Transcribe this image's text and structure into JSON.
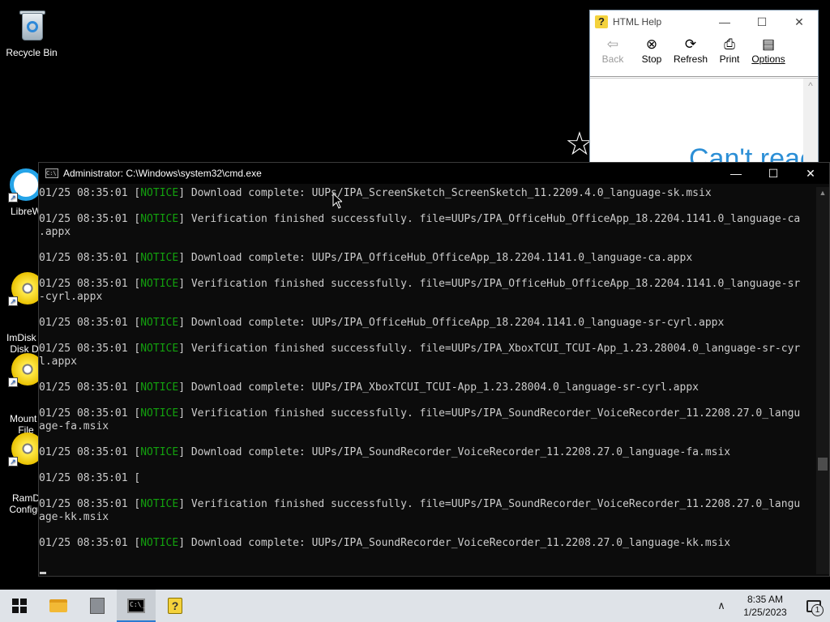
{
  "desktop": {
    "icons": [
      {
        "label": "Recycle Bin",
        "icon": "recycle-bin-icon"
      },
      {
        "label": "LibreW",
        "icon": "libreoffice-icon"
      },
      {
        "label": "ImDisk V\nDisk Dr",
        "icon": "disc-icon"
      },
      {
        "label": "Mount I\nFile",
        "icon": "disc-icon"
      },
      {
        "label": "RamD\nConfigu",
        "icon": "disc-icon"
      }
    ]
  },
  "help_window": {
    "title": "HTML Help",
    "toolbar": [
      {
        "label": "Back",
        "icon": "back-arrow-icon",
        "enabled": false
      },
      {
        "label": "Stop",
        "icon": "stop-icon",
        "enabled": true
      },
      {
        "label": "Refresh",
        "icon": "refresh-icon",
        "enabled": true
      },
      {
        "label": "Print",
        "icon": "print-icon",
        "enabled": true
      },
      {
        "label": "Options",
        "icon": "options-icon",
        "enabled": true
      }
    ],
    "content_text": "Can't reac"
  },
  "cmd_window": {
    "title": "Administrator: C:\\Windows\\system32\\cmd.exe",
    "lines": [
      {
        "ts": "01/25 08:35:01 [",
        "tag": "NOTICE",
        "msg": "] Download complete: UUPs/IPA_ScreenSketch_ScreenSketch_11.2209.4.0_language-sk.msix"
      },
      {
        "ts": "",
        "tag": "",
        "msg": ""
      },
      {
        "ts": "01/25 08:35:01 [",
        "tag": "NOTICE",
        "msg": "] Verification finished successfully. file=UUPs/IPA_OfficeHub_OfficeApp_18.2204.1141.0_language-ca"
      },
      {
        "ts": "",
        "tag": "",
        "msg": ".appx"
      },
      {
        "ts": "",
        "tag": "",
        "msg": ""
      },
      {
        "ts": "01/25 08:35:01 [",
        "tag": "NOTICE",
        "msg": "] Download complete: UUPs/IPA_OfficeHub_OfficeApp_18.2204.1141.0_language-ca.appx"
      },
      {
        "ts": "",
        "tag": "",
        "msg": ""
      },
      {
        "ts": "01/25 08:35:01 [",
        "tag": "NOTICE",
        "msg": "] Verification finished successfully. file=UUPs/IPA_OfficeHub_OfficeApp_18.2204.1141.0_language-sr"
      },
      {
        "ts": "",
        "tag": "",
        "msg": "-cyrl.appx"
      },
      {
        "ts": "",
        "tag": "",
        "msg": ""
      },
      {
        "ts": "01/25 08:35:01 [",
        "tag": "NOTICE",
        "msg": "] Download complete: UUPs/IPA_OfficeHub_OfficeApp_18.2204.1141.0_language-sr-cyrl.appx"
      },
      {
        "ts": "",
        "tag": "",
        "msg": ""
      },
      {
        "ts": "01/25 08:35:01 [",
        "tag": "NOTICE",
        "msg": "] Verification finished successfully. file=UUPs/IPA_XboxTCUI_TCUI-App_1.23.28004.0_language-sr-cyr"
      },
      {
        "ts": "",
        "tag": "",
        "msg": "l.appx"
      },
      {
        "ts": "",
        "tag": "",
        "msg": ""
      },
      {
        "ts": "01/25 08:35:01 [",
        "tag": "NOTICE",
        "msg": "] Download complete: UUPs/IPA_XboxTCUI_TCUI-App_1.23.28004.0_language-sr-cyrl.appx"
      },
      {
        "ts": "",
        "tag": "",
        "msg": ""
      },
      {
        "ts": "01/25 08:35:01 [",
        "tag": "NOTICE",
        "msg": "] Verification finished successfully. file=UUPs/IPA_SoundRecorder_VoiceRecorder_11.2208.27.0_langu"
      },
      {
        "ts": "",
        "tag": "",
        "msg": "age-fa.msix"
      },
      {
        "ts": "",
        "tag": "",
        "msg": ""
      },
      {
        "ts": "01/25 08:35:01 [",
        "tag": "NOTICE",
        "msg": "] Download complete: UUPs/IPA_SoundRecorder_VoiceRecorder_11.2208.27.0_language-fa.msix"
      },
      {
        "ts": "",
        "tag": "",
        "msg": ""
      },
      {
        "ts": "01/25 08:35:01 [",
        "tag": "",
        "msg": ""
      },
      {
        "ts": "",
        "tag": "",
        "msg": ""
      },
      {
        "ts": "01/25 08:35:01 [",
        "tag": "NOTICE",
        "msg": "] Verification finished successfully. file=UUPs/IPA_SoundRecorder_VoiceRecorder_11.2208.27.0_langu"
      },
      {
        "ts": "",
        "tag": "",
        "msg": "age-kk.msix"
      },
      {
        "ts": "",
        "tag": "",
        "msg": ""
      },
      {
        "ts": "01/25 08:35:01 [",
        "tag": "NOTICE",
        "msg": "] Download complete: UUPs/IPA_SoundRecorder_VoiceRecorder_11.2208.27.0_language-kk.msix"
      }
    ]
  },
  "taskbar": {
    "apps": [
      {
        "name": "file-explorer-icon"
      },
      {
        "name": "server-manager-icon"
      },
      {
        "name": "command-prompt-icon"
      },
      {
        "name": "html-help-icon"
      }
    ],
    "time": "8:35 AM",
    "date": "1/25/2023",
    "notification_count": "1"
  }
}
